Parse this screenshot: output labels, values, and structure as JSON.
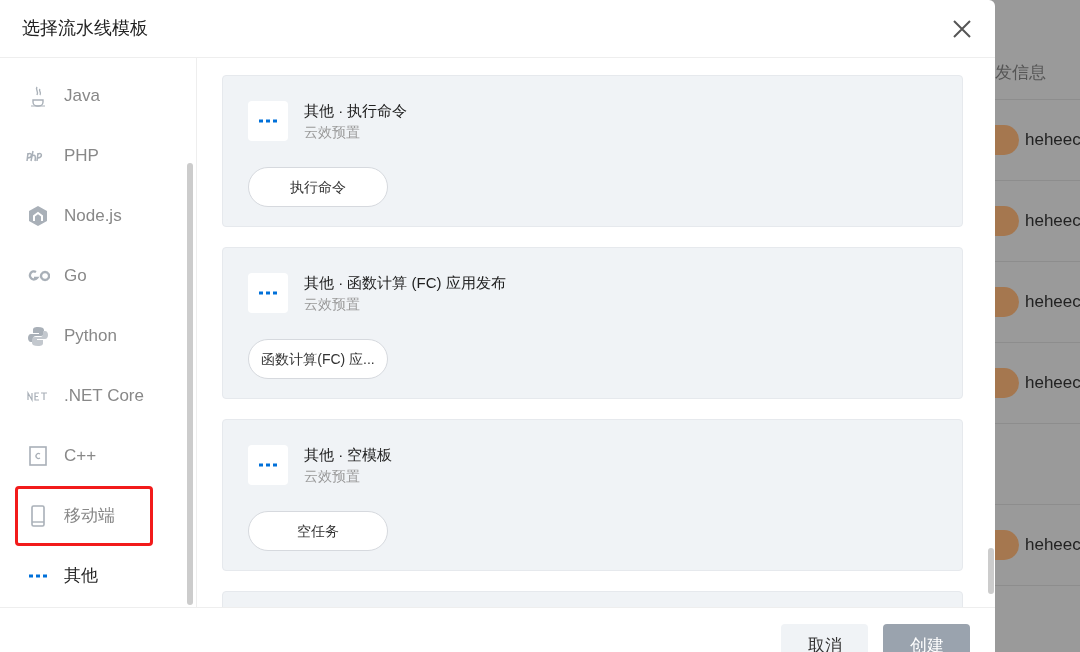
{
  "dialog": {
    "title": "选择流水线模板"
  },
  "sidebar": {
    "items": [
      {
        "kind": "java",
        "label": "Java",
        "selected": false,
        "highlighted": false
      },
      {
        "kind": "php",
        "label": "PHP",
        "selected": false,
        "highlighted": false
      },
      {
        "kind": "node",
        "label": "Node.js",
        "selected": false,
        "highlighted": false
      },
      {
        "kind": "go",
        "label": "Go",
        "selected": false,
        "highlighted": false
      },
      {
        "kind": "python",
        "label": "Python",
        "selected": false,
        "highlighted": false
      },
      {
        "kind": "net",
        "label": ".NET Core",
        "selected": false,
        "highlighted": false
      },
      {
        "kind": "cpp",
        "label": "C++",
        "selected": false,
        "highlighted": false
      },
      {
        "kind": "mobile",
        "label": "移动端",
        "selected": false,
        "highlighted": true
      },
      {
        "kind": "other",
        "label": "其他",
        "selected": true,
        "highlighted": false
      }
    ]
  },
  "templates": [
    {
      "title": "其他 · 执行命令",
      "source": "云效预置",
      "stages": [
        "执行命令"
      ]
    },
    {
      "title": "其他 · 函数计算 (FC) 应用发布",
      "source": "云效预置",
      "stages": [
        "函数计算(FC) 应..."
      ]
    },
    {
      "title": "其他 · 空模板",
      "source": "云效预置",
      "stages": [
        "空任务"
      ]
    }
  ],
  "footer": {
    "buttons": [
      {
        "label": "取消",
        "disabled": false
      },
      {
        "label": "创建",
        "disabled": true
      }
    ]
  },
  "background": {
    "column_header": "发信息",
    "rows": [
      "heheec",
      "heheec",
      "heheec",
      "heheec",
      "",
      "heheec"
    ]
  }
}
